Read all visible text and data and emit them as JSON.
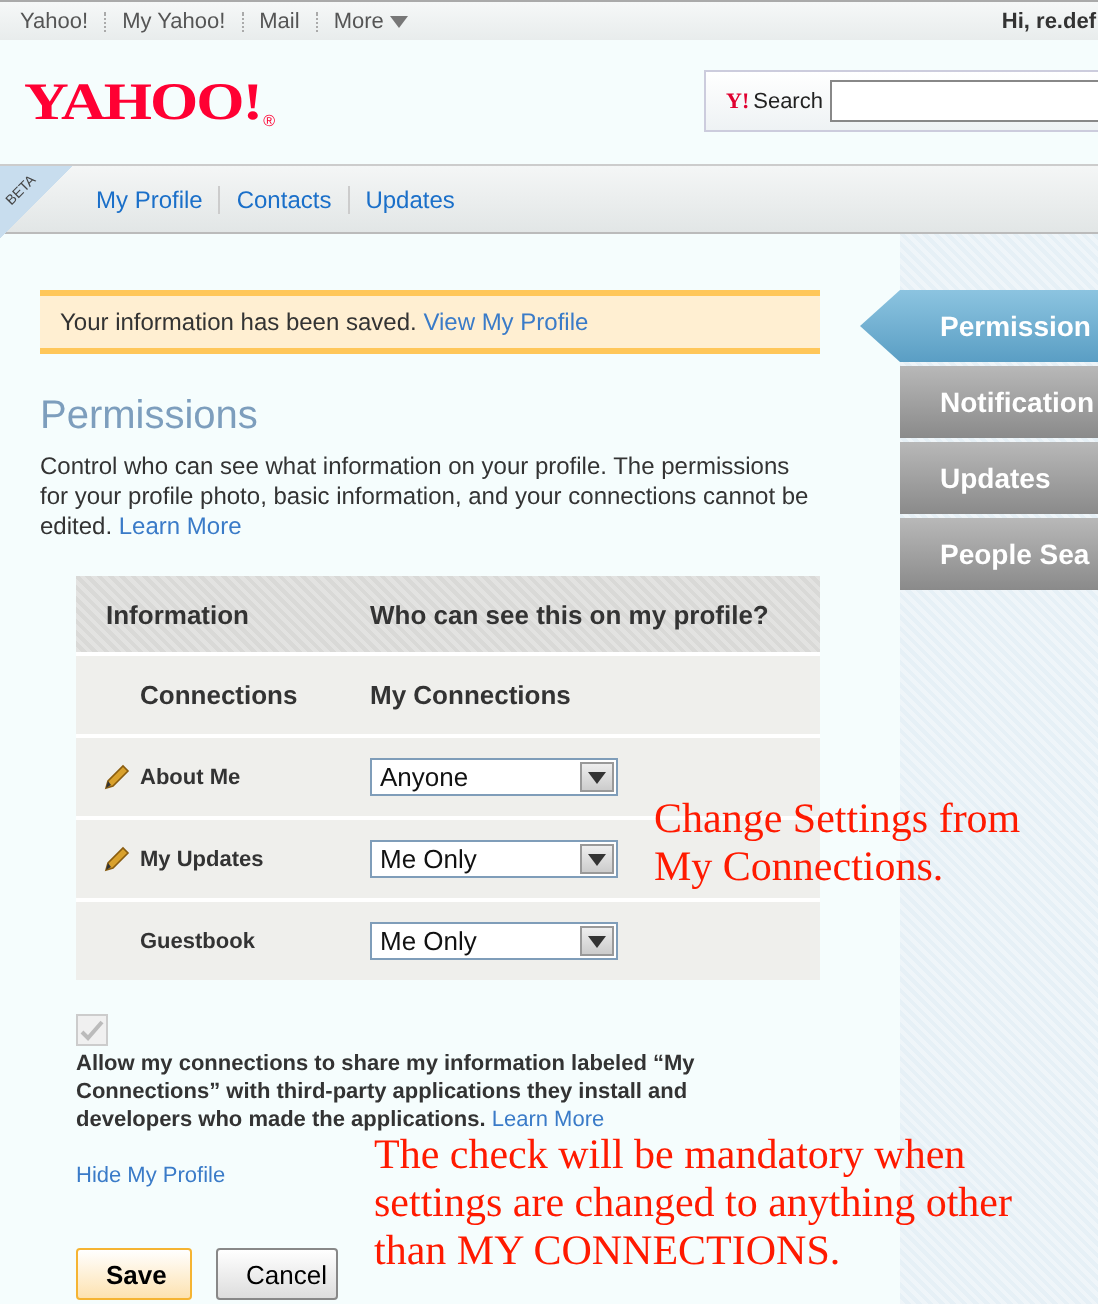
{
  "top_bar": {
    "links": [
      {
        "label": "Yahoo!",
        "kind": "link"
      },
      {
        "label": "My Yahoo!",
        "kind": "link"
      },
      {
        "label": "Mail",
        "kind": "link"
      },
      {
        "label": "More",
        "kind": "menu"
      }
    ],
    "greeting": "Hi, re.def"
  },
  "header": {
    "logo": "YAHOO!",
    "logo_mark": "®",
    "search": {
      "logo": "Y!",
      "label": "Search"
    }
  },
  "nav": {
    "badge": "BETA",
    "tabs": [
      {
        "label": "My Profile"
      },
      {
        "label": "Contacts"
      },
      {
        "label": "Updates"
      }
    ]
  },
  "notice": {
    "text": "Your information has been saved.",
    "link": "View My Profile"
  },
  "title": "Permissions",
  "description": {
    "text": "Control who can see what information on your profile. The permissions for your profile photo, basic information, and your connections cannot be edited.",
    "link": "Learn More"
  },
  "table": {
    "columns": [
      "Information",
      "Who can see this on my profile?"
    ],
    "rows": [
      {
        "kind": "fixed",
        "editable": false,
        "name": "Connections",
        "value": "My Connections"
      },
      {
        "kind": "select",
        "editable": true,
        "name": "About Me",
        "value": "Anyone"
      },
      {
        "kind": "select",
        "editable": true,
        "name": "My Updates",
        "value": "Me Only"
      },
      {
        "kind": "select",
        "editable": false,
        "name": "Guestbook",
        "value": "Me Only"
      }
    ]
  },
  "share": {
    "checked": true,
    "disabled": true,
    "text": "Allow my connections to share my information labeled “My Connections” with third-party applications they install and developers who made the applications.",
    "link": "Learn More"
  },
  "hide_link": "Hide My Profile",
  "buttons": [
    {
      "label": "Save",
      "kind": "primary"
    },
    {
      "label": "Cancel",
      "kind": "secondary"
    }
  ],
  "side_tabs": [
    {
      "label": "Permission",
      "selected": true
    },
    {
      "label": "Notification",
      "selected": false
    },
    {
      "label": "Updates",
      "selected": false
    },
    {
      "label": "People Sea",
      "selected": false
    }
  ],
  "annotations": [
    "Change Settings from My Connections.",
    "The check will be mandatory when settings are changed to anything other than MY CONNECTIONS."
  ]
}
